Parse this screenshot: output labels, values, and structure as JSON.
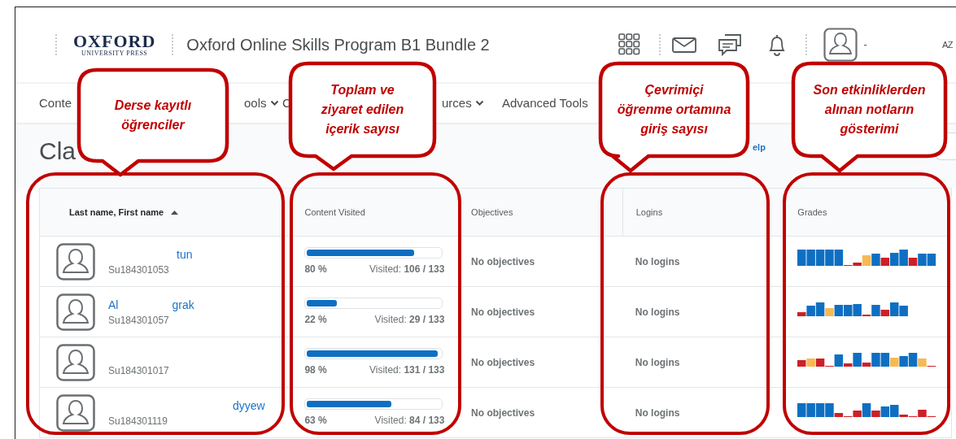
{
  "header": {
    "logo_top": "OXFORD",
    "logo_bottom": "UNIVERSITY PRESS",
    "title": "Oxford Online Skills Program B1 Bundle 2",
    "user_initial": "-",
    "user_name": "AZ"
  },
  "nav": [
    {
      "label": "Conte",
      "dropdown": false
    },
    {
      "label": "ools",
      "dropdown": true
    },
    {
      "label": "C",
      "dropdown": false
    },
    {
      "label": "urces",
      "dropdown": true
    },
    {
      "label": "Advanced Tools",
      "dropdown": false
    }
  ],
  "page": {
    "heading": "Cla",
    "help_link": "elp"
  },
  "table": {
    "columns": [
      {
        "label": "Last name, First name",
        "sorted": true
      },
      {
        "label": "Content Visited",
        "sorted": false
      },
      {
        "label": "Objectives",
        "sorted": false
      },
      {
        "label": "Logins",
        "sorted": false
      },
      {
        "label": "Grades",
        "sorted": false
      }
    ],
    "rows": [
      {
        "name_parts": [
          "tun"
        ],
        "id": "Su184301053",
        "content": {
          "level": 0.8,
          "percent": "80 %",
          "visited_label": "Visited:",
          "visited": "106 / 133"
        },
        "objectives": "No objectives",
        "logins": "No logins"
      },
      {
        "name_parts": [
          "Al",
          "grak"
        ],
        "id": "Su184301057",
        "content": {
          "level": 0.22,
          "percent": "22 %",
          "visited_label": "Visited:",
          "visited": "29 / 133"
        },
        "objectives": "No objectives",
        "logins": "No logins"
      },
      {
        "name_parts": [],
        "id": "Su184301017",
        "content": {
          "level": 0.98,
          "percent": "98 %",
          "visited_label": "Visited:",
          "visited": "131 / 133"
        },
        "objectives": "No objectives",
        "logins": "No logins"
      },
      {
        "name_parts": [
          "dyyew"
        ],
        "id": "Su184301119",
        "content": {
          "level": 0.63,
          "percent": "63 %",
          "visited_label": "Visited:",
          "visited": "84 / 133"
        },
        "objectives": "No objectives",
        "logins": "No logins"
      }
    ]
  },
  "callouts": [
    {
      "text": "Derse kayıtlı öğrenciler"
    },
    {
      "text": "Toplam ve ziyaret edilen içerik sayısı"
    },
    {
      "text": "Çevrimiçi öğrenme ortamına giriş sayısı"
    },
    {
      "text": "Son etkinliklerden alınan notların gösterimi"
    }
  ]
}
